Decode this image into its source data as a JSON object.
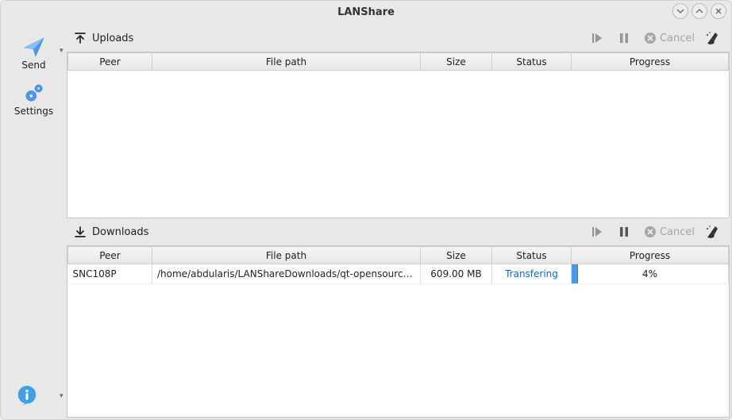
{
  "window": {
    "title": "LANShare"
  },
  "sidebar": {
    "send": {
      "label": "Send"
    },
    "settings": {
      "label": "Settings"
    }
  },
  "uploads": {
    "title": "Uploads",
    "cancel_label": "Cancel",
    "columns": {
      "peer": "Peer",
      "file": "File path",
      "size": "Size",
      "status": "Status",
      "progress": "Progress"
    },
    "rows": []
  },
  "downloads": {
    "title": "Downloads",
    "cancel_label": "Cancel",
    "columns": {
      "peer": "Peer",
      "file": "File path",
      "size": "Size",
      "status": "Status",
      "progress": "Progress"
    },
    "rows": [
      {
        "peer": "SNC108P",
        "file": "/home/abdularis/LANShareDownloads/qt-opensource-lin…",
        "size": "609.00 MB",
        "status": "Transfering",
        "progress_pct": 4,
        "progress_label": "4%"
      }
    ]
  }
}
